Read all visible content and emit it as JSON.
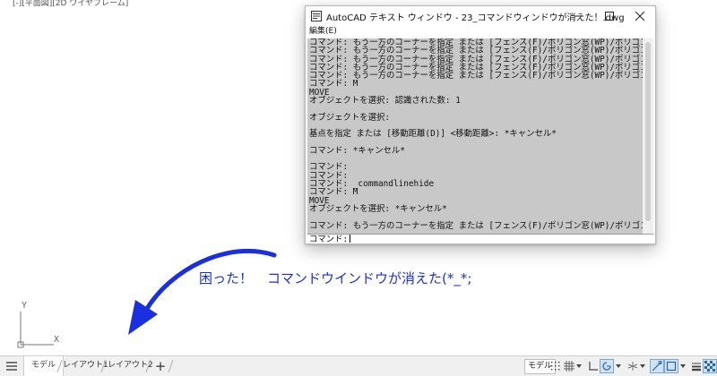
{
  "viewport": {
    "label": "[-][平面図][2D ワイヤフレーム]"
  },
  "ucs": {
    "y_label": "Y",
    "x_label": "X"
  },
  "text_window": {
    "title": "AutoCAD テキスト ウィンドウ - 23_コマンドウィンドウが消えた！.dwg",
    "menu_edit": "編集(E)",
    "log_lines": [
      "コマンド: もう一方のコーナーを指定 または [フェンス(F)/ポリゴン窓(WP)/ポリゴン",
      "コマンド: もう一方のコーナーを指定 または [フェンス(F)/ポリゴン窓(WP)/ポリゴン",
      "コマンド: もう一方のコーナーを指定 または [フェンス(F)/ポリゴン窓(WP)/ポリゴン",
      "コマンド: もう一方のコーナーを指定 または [フェンス(F)/ポリゴン窓(WP)/ポリゴン",
      "コマンド: もう一方のコーナーを指定 または [フェンス(F)/ポリゴン窓(WP)/ポリゴン",
      "コマンド: M",
      "MOVE",
      "オブジェクトを選択: 認識された数: 1",
      "",
      "オブジェクトを選択:",
      "",
      "基点を指定 または [移動距離(D)] <移動距離>: *キャンセル*",
      "",
      "コマンド: *キャンセル*",
      "",
      "コマンド:",
      "コマンド:",
      "コマンド: _commandlinehide",
      "コマンド: M",
      "MOVE",
      "オブジェクトを選択: *キャンセル*",
      "",
      "コマンド: もう一方のコーナーを指定 または [フェンス(F)/ポリゴン窓(WP)/ポリゴン",
      ""
    ],
    "prompt": "コマンド:"
  },
  "annotation": {
    "text1": "困った！",
    "text2": "コマンドウインドウが消えた(*_*;",
    "color": "#1a30e0"
  },
  "tabs": {
    "model": "モデル",
    "layout1": "レイアウト1",
    "layout2": "レイアウト2",
    "add": "+"
  },
  "status": {
    "model_button": "モデル"
  }
}
